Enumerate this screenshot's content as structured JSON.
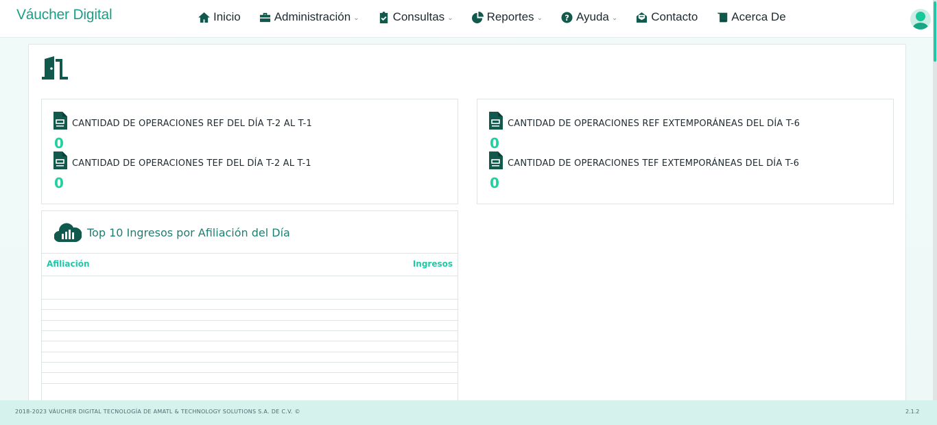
{
  "brand": "Váucher Digital",
  "nav": {
    "inicio": "Inicio",
    "administracion": "Administración",
    "consultas": "Consultas",
    "reportes": "Reportes",
    "ayuda": "Ayuda",
    "contacto": "Contacto",
    "acerca": "Acerca De",
    "caret": "⌄"
  },
  "stats_left": [
    {
      "label": "CANTIDAD DE OPERACIONES REF DEL DÍA T-2 AL T-1",
      "value": "0"
    },
    {
      "label": "CANTIDAD DE OPERACIONES TEF DEL DÍA T-2 AL T-1",
      "value": "0"
    }
  ],
  "stats_right": [
    {
      "label": "CANTIDAD DE OPERACIONES REF EXTEMPORÁNEAS DEL DÍA T-6",
      "value": "0"
    },
    {
      "label": "CANTIDAD DE OPERACIONES TEF EXTEMPORÁNEAS DEL DÍA T-6",
      "value": "0"
    }
  ],
  "top10": {
    "title": "Top 10 Ingresos por Afiliación del Día",
    "columns": [
      "Afiliación",
      "Ingresos"
    ]
  },
  "footer": {
    "copyright": "2018-2023 VÁUCHER DIGITAL TECNOLOGÍA DE AMATL & TECHNOLOGY SOLUTIONS S.A. DE C.V. ©",
    "version": "2.1.2"
  },
  "colors": {
    "accent": "#1a9e87",
    "value": "#1fd1a0",
    "icon": "#10594c"
  }
}
